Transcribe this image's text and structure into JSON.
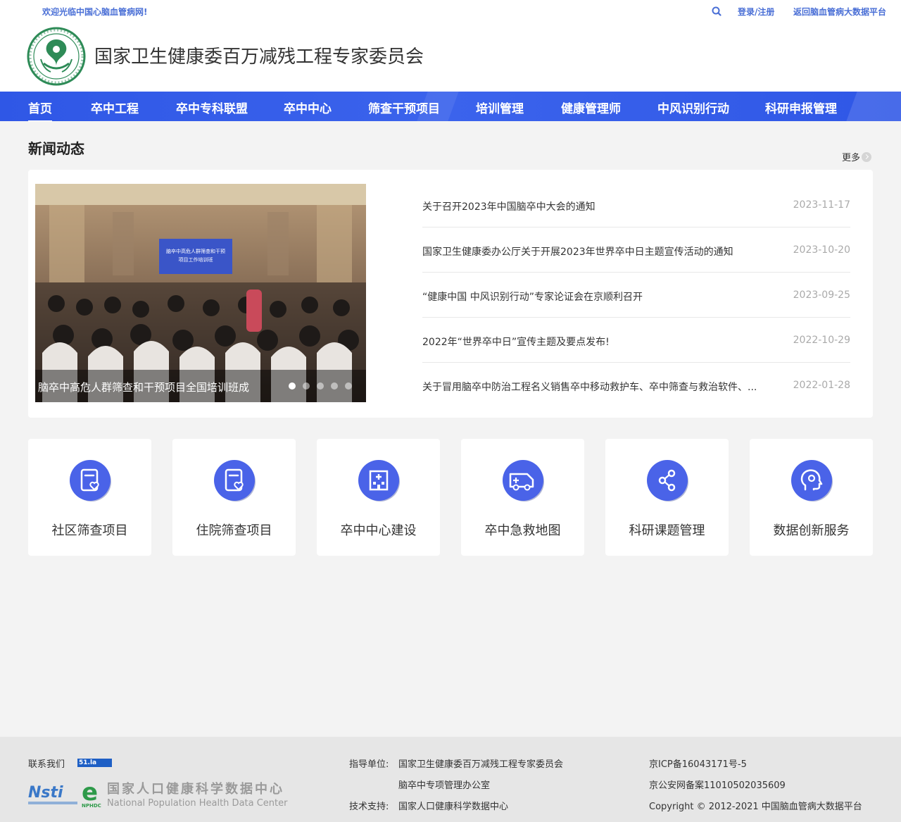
{
  "topbar": {
    "welcome": "欢迎光临中国心脑血管病网!",
    "login": "登录/注册",
    "back": "返回脑血管病大数据平台"
  },
  "header": {
    "title": "国家卫生健康委百万减残工程专家委员会"
  },
  "nav": {
    "items": [
      "首页",
      "卒中工程",
      "卒中专科联盟",
      "卒中中心",
      "筛查干预项目",
      "培训管理",
      "健康管理师",
      "中风识别行动",
      "科研申报管理"
    ]
  },
  "news": {
    "section_title": "新闻动态",
    "more": "更多",
    "slide_caption": "脑卒中高危人群筛查和干预项目全国培训班成",
    "slide_banner_line1": "脑卒中高危人群筛查和干预",
    "slide_banner_line2": "项目工作培训班",
    "items": [
      {
        "title": "关于召开2023年中国脑卒中大会的通知",
        "date": "2023-11-17"
      },
      {
        "title": "国家卫生健康委办公厅关于开展2023年世界卒中日主题宣传活动的通知",
        "date": "2023-10-20"
      },
      {
        "title": "“健康中国 中风识别行动”专家论证会在京顺利召开",
        "date": "2023-09-25"
      },
      {
        "title": "2022年“世界卒中日”宣传主题及要点发布!",
        "date": "2022-10-29"
      },
      {
        "title": "关于冒用脑卒中防治工程名义销售卒中移动救护车、卒中筛查与救治软件、...",
        "date": "2022-01-28"
      }
    ]
  },
  "services": [
    {
      "label": "社区筛查项目",
      "icon": "clipboard-heart-icon"
    },
    {
      "label": "住院筛查项目",
      "icon": "clipboard-heart-icon"
    },
    {
      "label": "卒中中心建设",
      "icon": "hospital-icon"
    },
    {
      "label": "卒中急救地图",
      "icon": "ambulance-icon"
    },
    {
      "label": "科研课题管理",
      "icon": "share-nodes-icon"
    },
    {
      "label": "数据创新服务",
      "icon": "head-brain-icon"
    }
  ],
  "footer": {
    "contact": "联系我们",
    "counter_label": "51.la",
    "guide_label": "指导单位:",
    "guide_1": "国家卫生健康委百万减残工程专家委员会",
    "guide_2": "脑卒中专项管理办公室",
    "tech_label": "技术支持:",
    "tech": "国家人口健康科学数据中心",
    "icp": "京ICP备16043171号-5",
    "police": "京公安网备案11010502035609",
    "copyright": "Copyright © 2012-2021 中国脑血管病大数据平台",
    "logo_cn": "国家人口健康科学数据中心",
    "logo_en": "National Population Health Data Center",
    "logo_abbr": "NPHDC",
    "nsti": "Nsti"
  },
  "colors": {
    "nav_blue": "#2f57e6",
    "link_blue": "#4a6fd6",
    "icon_blue": "#4a63e8"
  }
}
